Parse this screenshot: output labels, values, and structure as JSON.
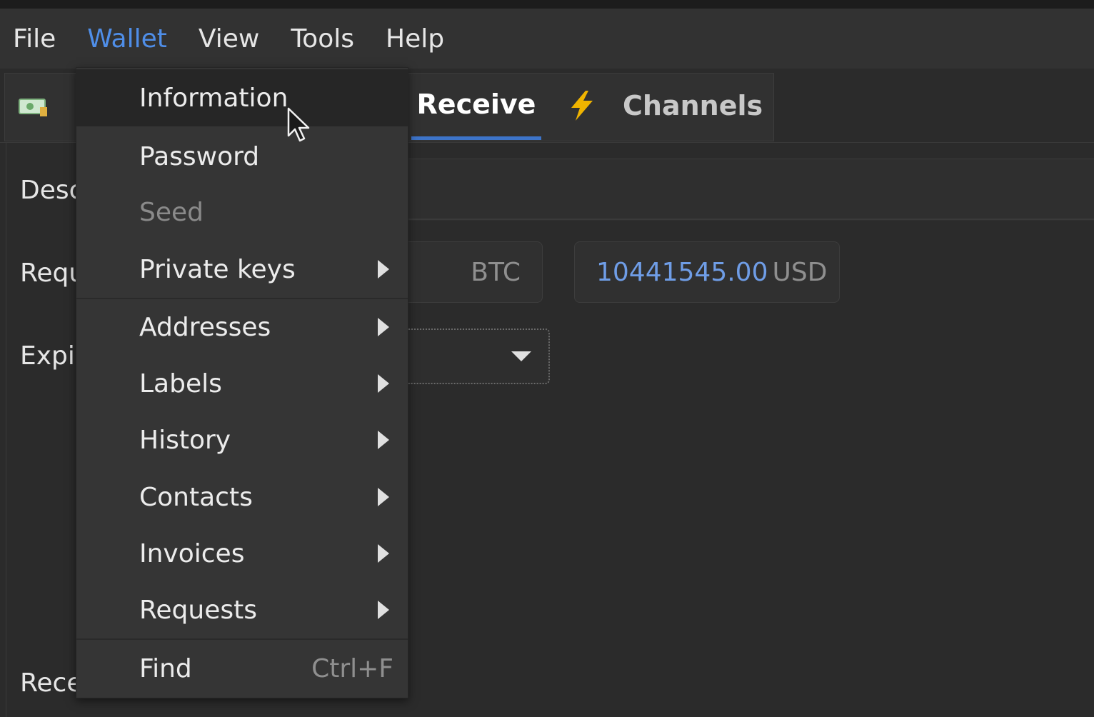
{
  "menubar": {
    "items": [
      {
        "label": "File",
        "active": false
      },
      {
        "label": "Wallet",
        "active": true
      },
      {
        "label": "View",
        "active": false
      },
      {
        "label": "Tools",
        "active": false
      },
      {
        "label": "Help",
        "active": false
      }
    ]
  },
  "tabs": {
    "receive": {
      "label": "Receive",
      "selected": true
    },
    "channels": {
      "label": "Channels",
      "icon": "lightning-icon"
    },
    "first_tab_icon": "wallet-icon"
  },
  "form": {
    "labels": {
      "description": "Desc",
      "requested": "Requ",
      "expiry": "Expi",
      "receive": "Rece"
    },
    "btc_unit": "BTC",
    "usd_amount": "10441545.00",
    "usd_unit": "USD"
  },
  "wallet_menu": {
    "information": "Information",
    "password": "Password",
    "seed": "Seed",
    "private_keys": "Private keys",
    "addresses": "Addresses",
    "labels": "Labels",
    "history": "History",
    "contacts": "Contacts",
    "invoices": "Invoices",
    "requests": "Requests",
    "find": "Find",
    "find_shortcut": "Ctrl+F"
  },
  "colors": {
    "accent": "#4f8ee8",
    "tab_underline": "#3d74c9",
    "lightning": "#f0b400",
    "fiat_amount": "#6f9de6"
  }
}
